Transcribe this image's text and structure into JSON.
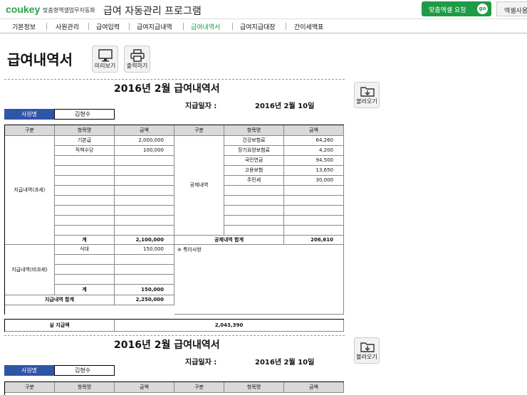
{
  "header": {
    "logo": "coukey",
    "logo_sub": "맞춤형엑셀업무자동화",
    "app_title": "급여 자동관리 프로그램",
    "request_button": "맞춤엑셀 요청",
    "go_badge": "go",
    "excel_button": "엑셀사용"
  },
  "nav": [
    "기본정보",
    "사원관리",
    "급여입력",
    "급여지급내역",
    "급여내역서",
    "급여지급대장",
    "간이세액표"
  ],
  "active_nav_index": 4,
  "page_title": "급여내역서",
  "tools": {
    "preview": "미리보기",
    "print": "출력하기"
  },
  "slip": {
    "title": "2016년 2월 급여내역서",
    "pay_date_label": "지급일자 :",
    "pay_date": "2016년 2월 10일",
    "load_button": "불러오기",
    "employee_label": "사원명",
    "employee_name": "김형수",
    "columns": {
      "category": "구분",
      "item": "항목명",
      "amount": "금액"
    },
    "taxable_label": "지급내역(과세)",
    "taxable_items": [
      {
        "name": "기본급",
        "amount": "2,000,000"
      },
      {
        "name": "직책수당",
        "amount": "100,000"
      }
    ],
    "subtotal_label": "계",
    "taxable_total": "2,100,000",
    "deduction_label": "공제내역",
    "deduction_items": [
      {
        "name": "건강보험료",
        "amount": "64,260"
      },
      {
        "name": "장기요양보험료",
        "amount": "4,200"
      },
      {
        "name": "국민연금",
        "amount": "94,500"
      },
      {
        "name": "고용보험",
        "amount": "13,650"
      },
      {
        "name": "주민세",
        "amount": "30,000"
      }
    ],
    "deduction_total_label": "공제내역 합계",
    "deduction_total": "206,610",
    "nontaxable_label": "지급내역(비과세)",
    "nontaxable_items": [
      {
        "name": "식대",
        "amount": "150,000"
      }
    ],
    "nontaxable_total": "150,000",
    "notes_label": "※ 특이사항",
    "pay_total_label": "지급내역 합계",
    "pay_total": "2,250,000",
    "net_pay_label": "실 지급액",
    "net_pay": "2,043,390"
  },
  "slip2": {
    "title": "2016년 2월 급여내역서",
    "pay_date_label": "지급일자 :",
    "pay_date": "2016년 2월 10일",
    "load_button": "불러오기",
    "employee_label": "사원명",
    "employee_name": "김형수",
    "columns": {
      "category": "구분",
      "item": "항목명",
      "amount": "금액"
    }
  },
  "colors": {
    "brand_green": "#1f9a45",
    "employee_header": "#2f55a8",
    "table_header": "#d9d9d9"
  }
}
